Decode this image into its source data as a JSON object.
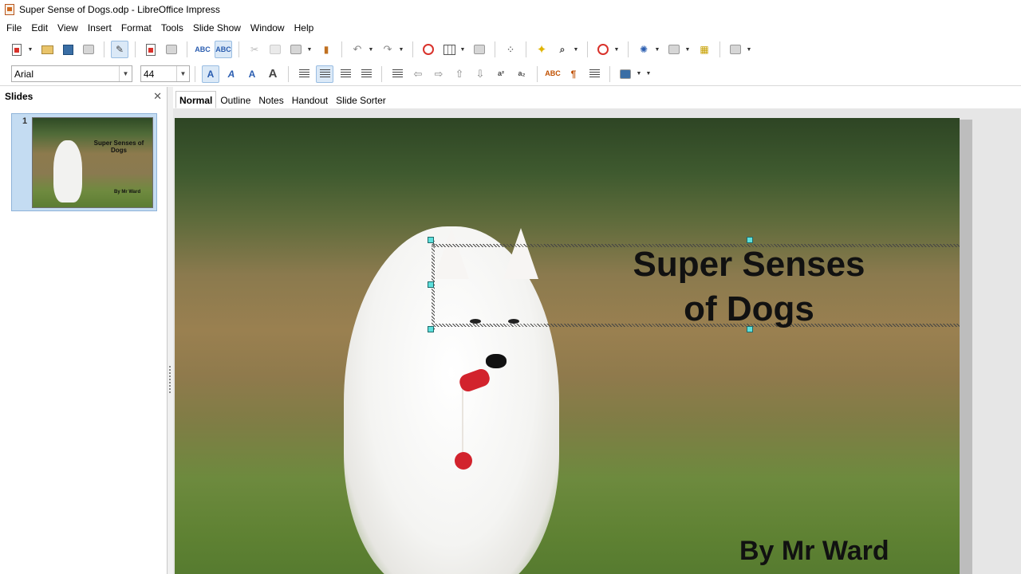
{
  "window": {
    "title": "Super Sense of Dogs.odp - LibreOffice Impress"
  },
  "menu": [
    "File",
    "Edit",
    "View",
    "Insert",
    "Format",
    "Tools",
    "Slide Show",
    "Window",
    "Help"
  ],
  "format_bar": {
    "font_name": "Arial",
    "font_size": "44"
  },
  "slides_pane": {
    "title": "Slides",
    "thumbnails": [
      {
        "number": "1",
        "title": "Super Senses of Dogs",
        "subtitle": "By Mr Ward"
      }
    ]
  },
  "view_tabs": [
    "Normal",
    "Outline",
    "Notes",
    "Handout",
    "Slide Sorter"
  ],
  "active_view_tab": "Normal",
  "slide": {
    "title_line1": "Super Senses",
    "title_line2": "of Dogs",
    "byline": "By Mr Ward"
  },
  "colors": {
    "selection_handle": "#5de0dd",
    "active_tab_bg": "#dbe9f7"
  }
}
